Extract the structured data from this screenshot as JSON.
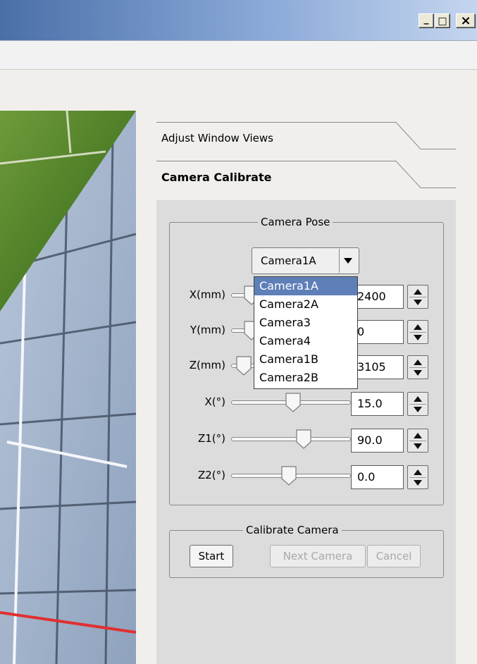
{
  "window": {
    "controls": [
      {
        "name": "minimize",
        "glyph": "_"
      },
      {
        "name": "maximize",
        "glyph": "□"
      },
      {
        "name": "close",
        "glyph": "×"
      }
    ]
  },
  "tabs": [
    {
      "label": "Adjust Window Views",
      "active": false
    },
    {
      "label": "Camera Calibrate",
      "active": true
    }
  ],
  "camera_pose": {
    "legend": "Camera Pose",
    "camera_select": {
      "selected": "Camera1A",
      "open": true,
      "options": [
        "Camera1A",
        "Camera2A",
        "Camera3",
        "Camera4",
        "Camera1B",
        "Camera2B"
      ]
    },
    "rows": [
      {
        "label": "X(mm)",
        "value": "2400",
        "level": 0.12
      },
      {
        "label": "Y(mm)",
        "value": "0",
        "level": 0.12
      },
      {
        "label": "Z(mm)",
        "value": "3105",
        "level": 0.05
      },
      {
        "label": "X(°)",
        "value": "15.0",
        "level": 0.52
      },
      {
        "label": "Z1(°)",
        "value": "90.0",
        "level": 0.62
      },
      {
        "label": "Z2(°)",
        "value": "0.0",
        "level": 0.48
      }
    ]
  },
  "calibrate_camera": {
    "legend": "Calibrate Camera",
    "start_label": "Start",
    "next_label": "Next Camera",
    "cancel_label": "Cancel"
  },
  "colors": {
    "title_bar": "#6a8cc4",
    "panel": "#dcdcdc",
    "selection": "#5e7fb8",
    "grass": "#5a8a2e",
    "sky_tiles": "#a9b9cf",
    "red_line": "#e03030"
  }
}
